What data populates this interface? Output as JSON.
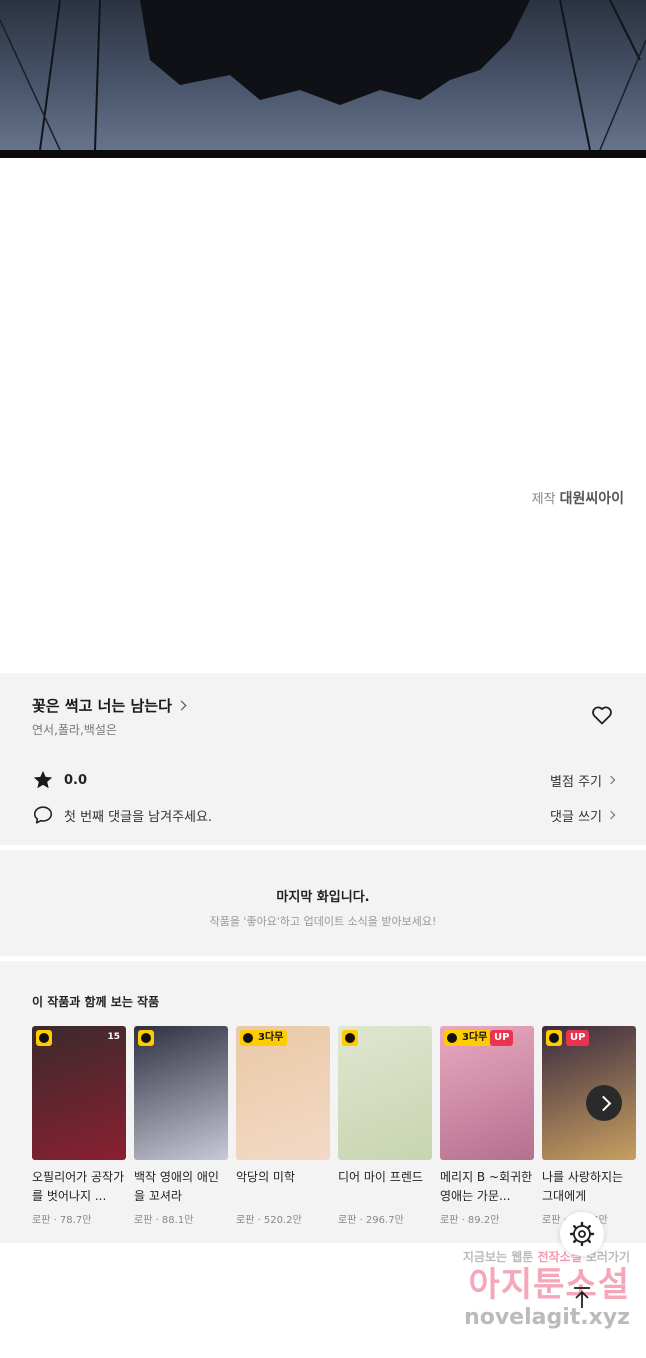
{
  "viewer": {
    "credit_prefix": "제작",
    "credit_name": "대원씨아이"
  },
  "series": {
    "title": "꽃은 썩고 너는 남는다",
    "authors": "연서,폴라,백설은",
    "rating_value": "0.0",
    "rate_link": "별점 주기",
    "comment_prompt": "첫 번째 댓글을 남겨주세요.",
    "comment_link": "댓글 쓰기"
  },
  "last_episode": {
    "title": "마지막 화입니다.",
    "subtitle": "작품을 '좋아요'하고 업데이트 소식을 받아보세요!"
  },
  "recommendations": {
    "heading": "이 작품과 함께 보는 작품",
    "items": [
      {
        "name": "오필리어가 공작가를 벗어나지 ...",
        "meta": "로판 · 78.7만",
        "badge": "",
        "up": false,
        "age": "15",
        "color1": "#3a2a2e",
        "color2": "#8a2030"
      },
      {
        "name": "백작 영애의 애인을 꼬셔라",
        "meta": "로판 · 88.1만",
        "badge": "",
        "up": false,
        "age": "",
        "color1": "#2e3040",
        "color2": "#c7c9d6"
      },
      {
        "name": "악당의 미학",
        "meta": "로판 · 520.2만",
        "badge": "3다무",
        "up": false,
        "age": "",
        "color1": "#e9c9a6",
        "color2": "#f3d9c6"
      },
      {
        "name": "디어 마이 프렌드",
        "meta": "로판 · 296.7만",
        "badge": "",
        "up": false,
        "age": "",
        "color1": "#dfe6cf",
        "color2": "#c8d4b0"
      },
      {
        "name": "메리지 B ~회귀한 영애는 가문...",
        "meta": "로판 · 89.2만",
        "badge": "3다무",
        "up": true,
        "age": "",
        "color1": "#e9a9bf",
        "color2": "#b4708f"
      },
      {
        "name": "나를 사랑하지는 그대에게",
        "meta": "로판 · 102.4만",
        "badge": "",
        "up": true,
        "age": "",
        "color1": "#3a2a40",
        "color2": "#c9a060"
      }
    ]
  },
  "watermark": {
    "line1_a": "지금보는 웹툰",
    "line1_b": "전작소설",
    "line1_c": "보러가기",
    "line2": "아지툰소설",
    "line3": "novelagit.xyz"
  },
  "colors": {
    "panel_bg": "#f3f3f3",
    "badge_yellow": "#ffcc00",
    "badge_up": "#e8344e"
  }
}
